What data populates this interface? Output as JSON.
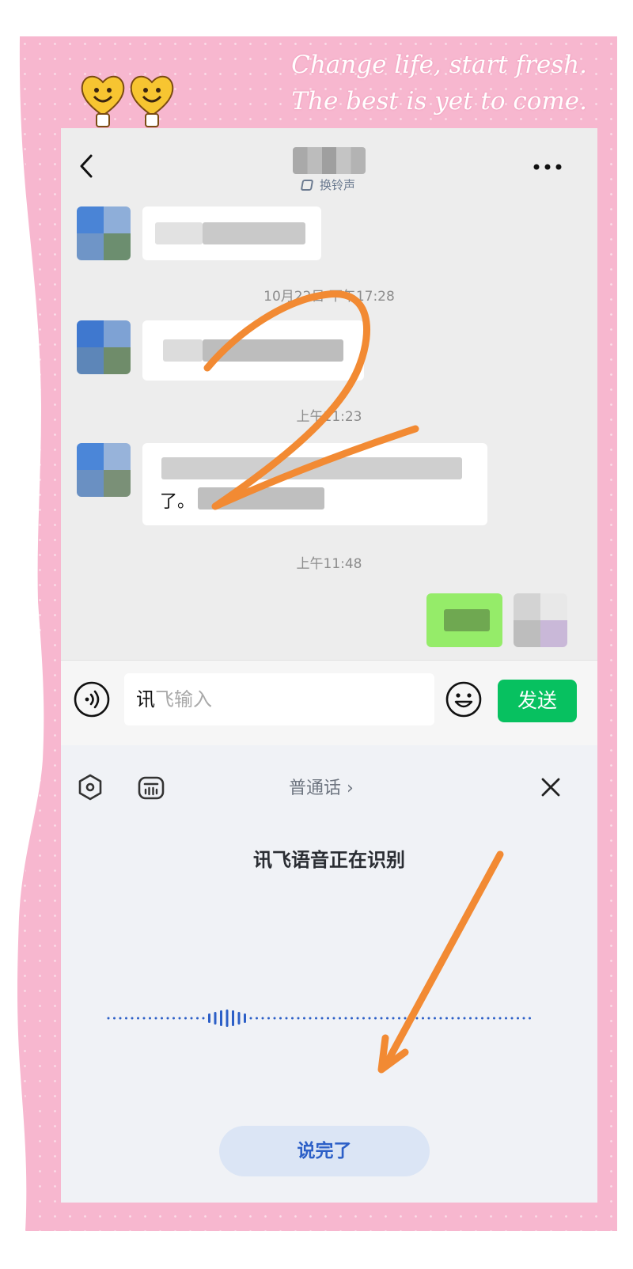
{
  "decor": {
    "slogan_line1": "Change life, start fresh.",
    "slogan_line2": "The best is yet to come.",
    "frame_color": "#f7b7cf",
    "annotation_number": "2",
    "annotation_color": "#f28a33"
  },
  "header": {
    "back_icon": "chevron-left-icon",
    "contact_name": "",
    "ringtone_label": "换铃声",
    "more_icon": "more-dots-icon"
  },
  "chat": {
    "timestamps": [
      "10月22日 下午17:28",
      "上午11:23",
      "上午11:48"
    ],
    "message3_tail": "了。"
  },
  "input_bar": {
    "voice_icon": "voice-mode-icon",
    "input_typed": "讯",
    "input_placeholder": "飞输入",
    "emoji_icon": "emoji-icon",
    "send_label": "发送",
    "send_color": "#07c160"
  },
  "voice_panel": {
    "settings_icon": "settings-hex-icon",
    "keyboard_icon": "voice-keyboard-icon",
    "language": "普通话 ›",
    "close_icon": "close-icon",
    "status": "讯飞语音正在识别",
    "done_label": "说完了",
    "accent_color": "#2c5fc7"
  }
}
